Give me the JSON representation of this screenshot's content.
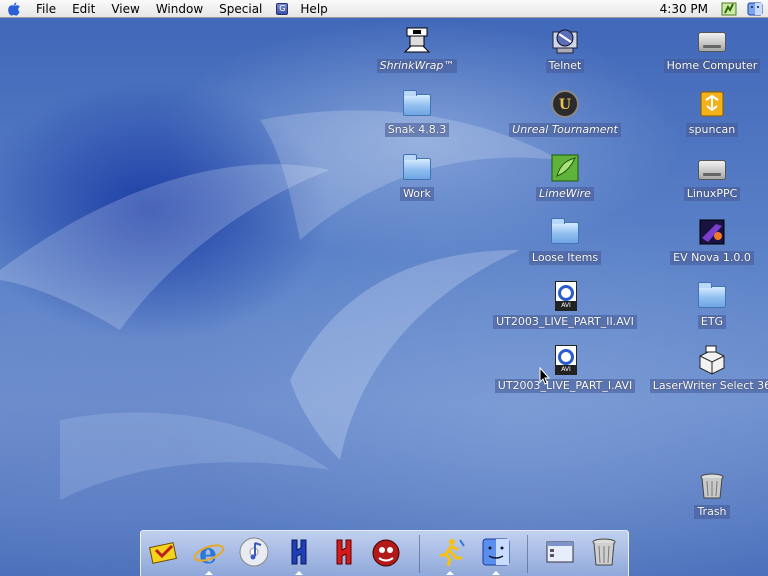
{
  "menubar": {
    "apple_icon": "apple-logo-icon",
    "menus": [
      "File",
      "Edit",
      "View",
      "Window",
      "Special",
      "Help"
    ],
    "app_icon": "application-menu-icon",
    "clock": "4:30 PM",
    "status_icons": [
      "network-status-icon",
      "finder-menu-icon"
    ]
  },
  "desktop": {
    "icons": [
      {
        "name": "shrinkwrap",
        "label": "ShrinkWrap™",
        "icon": "shrinkwrap-app-icon",
        "alias": true
      },
      {
        "name": "telnet",
        "label": "Telnet",
        "icon": "telnet-app-icon",
        "alias": false
      },
      {
        "name": "home-computer",
        "label": "Home Computer",
        "icon": "hard-disk-icon",
        "alias": false
      },
      {
        "name": "snak",
        "label": "Snak 4.8.3",
        "icon": "folder-icon",
        "alias": false
      },
      {
        "name": "unreal-tournament",
        "label": "Unreal Tournament",
        "icon": "unreal-app-icon",
        "alias": true
      },
      {
        "name": "spuncan",
        "label": "spuncan",
        "icon": "shared-volume-icon",
        "alias": false
      },
      {
        "name": "work",
        "label": "Work",
        "icon": "folder-icon",
        "alias": false
      },
      {
        "name": "limewire",
        "label": "LimeWire",
        "icon": "limewire-app-icon",
        "alias": true
      },
      {
        "name": "linuxppc",
        "label": "LinuxPPC",
        "icon": "hard-disk-icon",
        "alias": false
      },
      {
        "name": "loose-items",
        "label": "Loose Items",
        "icon": "folder-icon",
        "alias": false
      },
      {
        "name": "ev-nova",
        "label": "EV Nova 1.0.0",
        "icon": "ev-nova-app-icon",
        "alias": false
      },
      {
        "name": "ut2003-part-ii",
        "label": "UT2003_LIVE_PART_II.AVI",
        "icon": "avi-file-icon",
        "alias": false
      },
      {
        "name": "etg",
        "label": "ETG",
        "icon": "folder-icon",
        "alias": false
      },
      {
        "name": "ut2003-part-i",
        "label": "UT2003_LIVE_PART_I.AVI",
        "icon": "avi-file-icon",
        "alias": false
      },
      {
        "name": "laserwriter",
        "label": "LaserWriter Select 36",
        "icon": "printer-icon",
        "alias": false
      },
      {
        "name": "trash",
        "label": "Trash",
        "icon": "trash-icon",
        "alias": false
      }
    ]
  },
  "dock": {
    "items": [
      {
        "name": "dock-mail",
        "icon": "mail-stamp-icon",
        "running": false
      },
      {
        "name": "dock-internet-explorer",
        "icon": "internet-explorer-icon",
        "running": true
      },
      {
        "name": "dock-itunes",
        "icon": "itunes-cd-icon",
        "running": false
      },
      {
        "name": "dock-app-h-blue",
        "icon": "hotline-blue-icon",
        "running": true
      },
      {
        "name": "dock-app-h-red",
        "icon": "hotline-red-icon",
        "running": false
      },
      {
        "name": "dock-game",
        "icon": "game-app-icon",
        "running": false
      },
      {
        "name": "dock-runner",
        "icon": "runner-app-icon",
        "running": true
      },
      {
        "name": "dock-finder",
        "icon": "finder-face-icon",
        "running": true
      },
      {
        "name": "dock-minimized-window",
        "icon": "minimized-window-icon",
        "running": false
      },
      {
        "name": "dock-trash",
        "icon": "dock-trash-icon",
        "running": false
      }
    ]
  },
  "colors": {
    "desktop_blue": "#4f74bf",
    "label_bg": "#46609a",
    "menubar": "#eeeeee"
  }
}
